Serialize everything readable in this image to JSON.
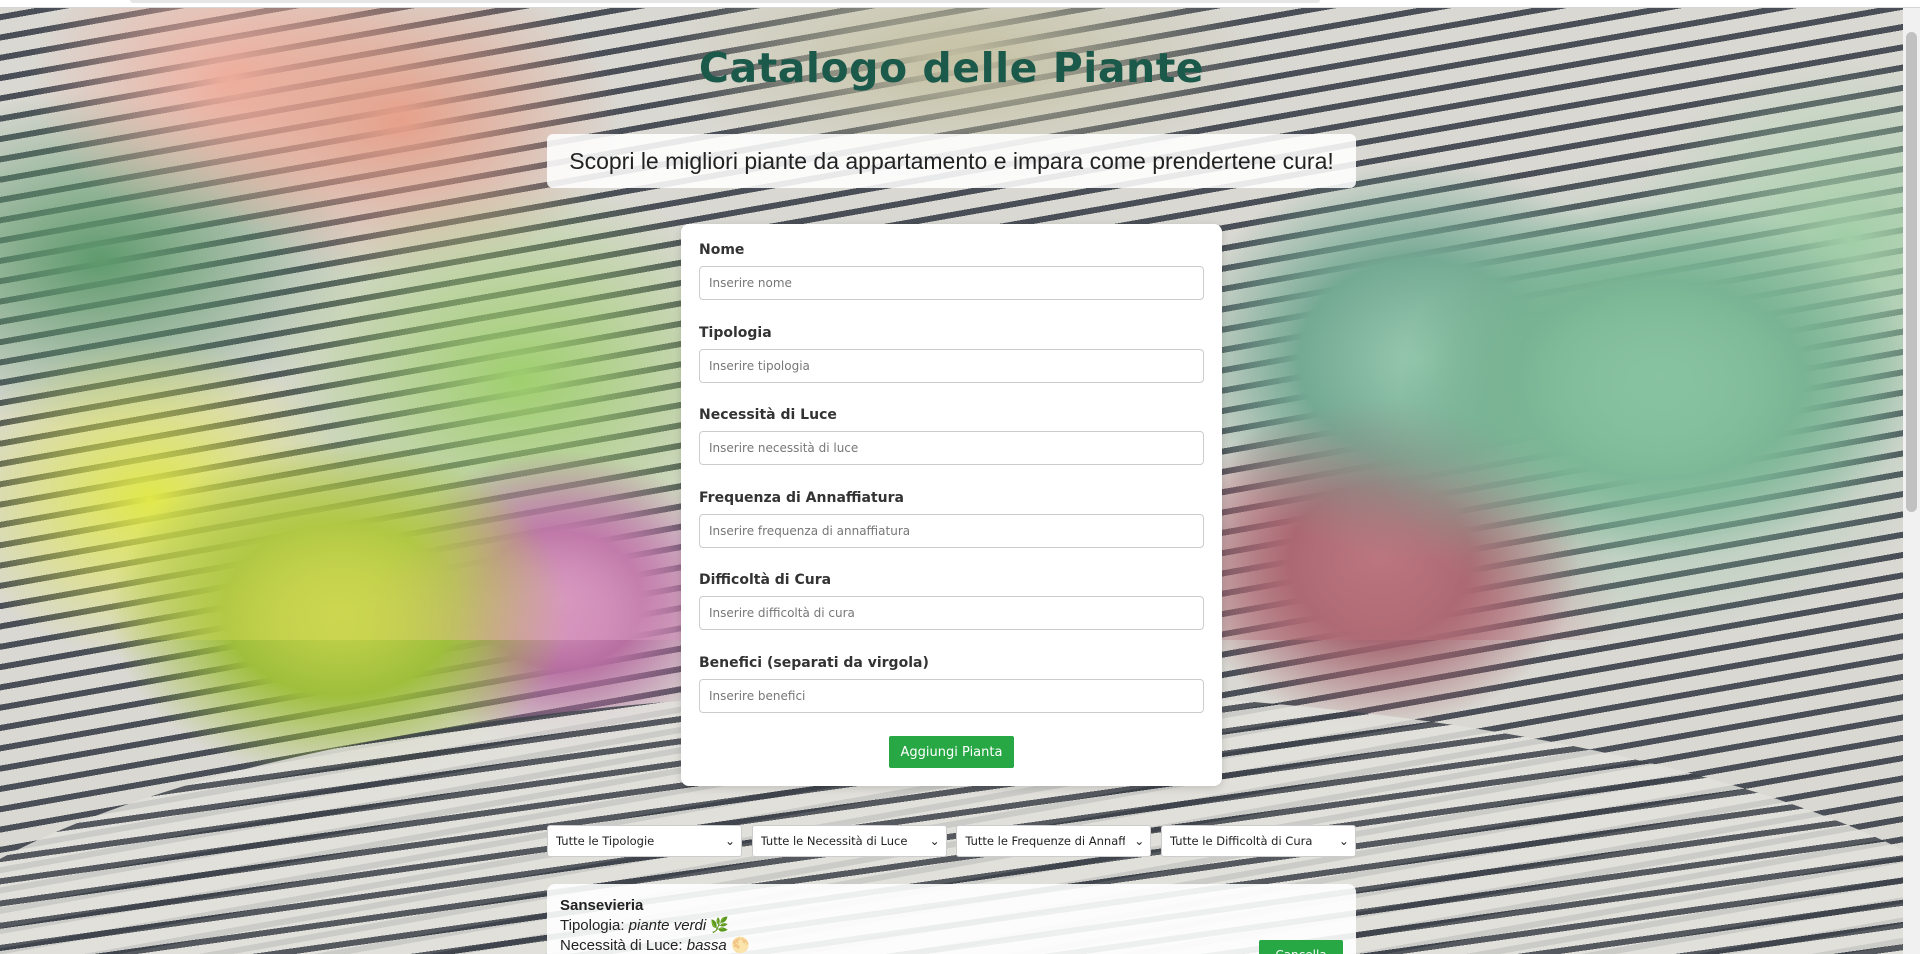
{
  "header": {
    "title": "Catalogo delle Piante",
    "subtitle": "Scopri le migliori piante da appartamento e impara come prendertene cura!"
  },
  "form": {
    "fields": [
      {
        "label": "Nome",
        "placeholder": "Inserire nome",
        "value": ""
      },
      {
        "label": "Tipologia",
        "placeholder": "Inserire tipologia",
        "value": ""
      },
      {
        "label": "Necessità di Luce",
        "placeholder": "Inserire necessità di luce",
        "value": ""
      },
      {
        "label": "Frequenza di Annaffiatura",
        "placeholder": "Inserire frequenza di annaffiatura",
        "value": ""
      },
      {
        "label": "Difficoltà di Cura",
        "placeholder": "Inserire difficoltà di cura",
        "value": ""
      },
      {
        "label": "Benefici (separati da virgola)",
        "placeholder": "Inserire benefici",
        "value": ""
      }
    ],
    "submit_label": "Aggiungi Pianta"
  },
  "filters": [
    {
      "selected": "Tutte le Tipologie"
    },
    {
      "selected": "Tutte le Necessità di Luce"
    },
    {
      "selected": "Tutte le Frequenze di Annaffiatura"
    },
    {
      "selected": "Tutte le Difficoltà di Cura"
    }
  ],
  "plants": [
    {
      "name": "Sansevieria",
      "type_label": "Tipologia:",
      "type_value": "piante verdi",
      "type_icon": "🌿",
      "light_label": "Necessità di Luce:",
      "light_value": "bassa",
      "light_icon": "🌕",
      "delete_label": "Cancella"
    }
  ],
  "colors": {
    "title": "#1b5a4a",
    "accent": "#28a745"
  }
}
